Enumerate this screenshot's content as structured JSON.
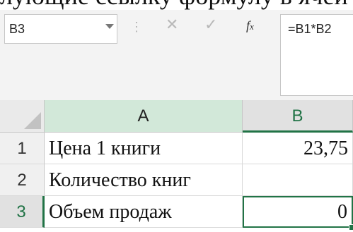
{
  "cropped_text_above": "лующие ссылку формулу в ячей",
  "formula_bar": {
    "name_box": "B3",
    "cancel_icon": "✕",
    "enter_icon": "✓",
    "fx_label": "fx",
    "formula": "=B1*B2"
  },
  "columns": [
    "A",
    "B"
  ],
  "rows": [
    {
      "number": "1",
      "a": "Цена 1 книги",
      "b": "23,75"
    },
    {
      "number": "2",
      "a": "Количество книг",
      "b": ""
    },
    {
      "number": "3",
      "a": "Объем продаж",
      "b": "0"
    }
  ],
  "selected_cell": "B3",
  "colors": {
    "accent": "#217346",
    "header_highlight": "#d2e8d9"
  }
}
